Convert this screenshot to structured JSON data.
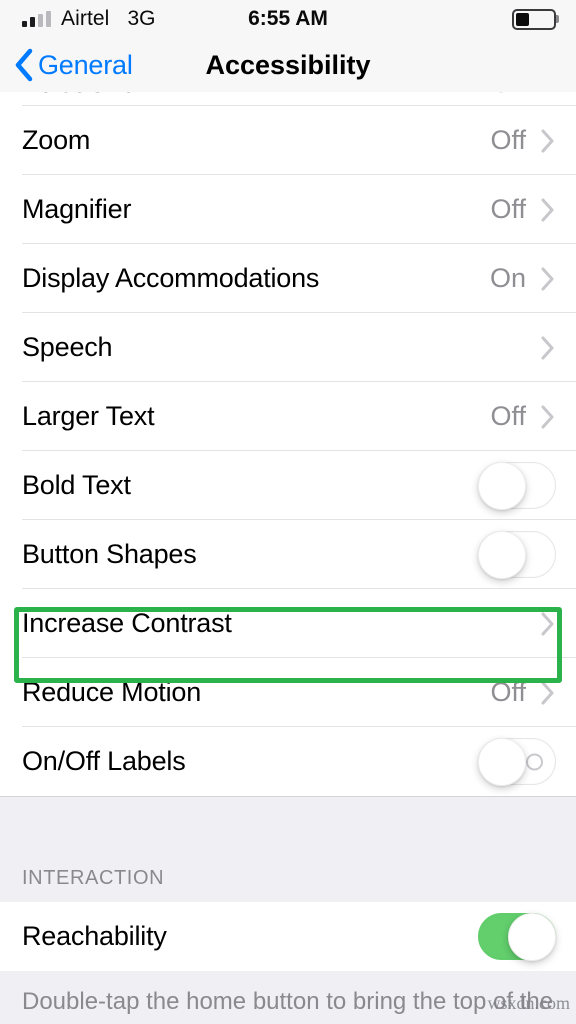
{
  "status_bar": {
    "carrier": "Airtel",
    "network": "3G",
    "time": "6:55 AM",
    "signal_bars_filled": 2,
    "signal_bars_total": 4,
    "battery_percent": 35
  },
  "nav": {
    "back_label": "General",
    "title": "Accessibility"
  },
  "colors": {
    "accent_blue": "#007AFF",
    "toggle_on_green": "#62CE6C",
    "highlight_green": "#2CB24A",
    "value_gray": "#8e8e93",
    "group_bg": "#EFEFF4"
  },
  "vision_section": {
    "rows": [
      {
        "label": "VoiceOver",
        "value": "Off",
        "accessory": "chevron",
        "clipped": true
      },
      {
        "label": "Zoom",
        "value": "Off",
        "accessory": "chevron"
      },
      {
        "label": "Magnifier",
        "value": "Off",
        "accessory": "chevron"
      },
      {
        "label": "Display Accommodations",
        "value": "On",
        "accessory": "chevron"
      },
      {
        "label": "Speech",
        "value": "",
        "accessory": "chevron"
      },
      {
        "label": "Larger Text",
        "value": "Off",
        "accessory": "chevron"
      },
      {
        "label": "Bold Text",
        "value": "",
        "accessory": "toggle",
        "toggle_on": false
      },
      {
        "label": "Button Shapes",
        "value": "",
        "accessory": "toggle",
        "toggle_on": false
      },
      {
        "label": "Increase Contrast",
        "value": "",
        "accessory": "chevron",
        "highlighted": true
      },
      {
        "label": "Reduce Motion",
        "value": "Off",
        "accessory": "chevron"
      },
      {
        "label": "On/Off Labels",
        "value": "",
        "accessory": "toggle",
        "toggle_on": false,
        "shows_onoff_label": true
      }
    ]
  },
  "interaction_section": {
    "header": "INTERACTION",
    "rows": [
      {
        "label": "Reachability",
        "value": "",
        "accessory": "toggle",
        "toggle_on": true
      }
    ],
    "footer": "Double-tap the home button to bring the top of the"
  },
  "watermark": "wsxdn.com"
}
